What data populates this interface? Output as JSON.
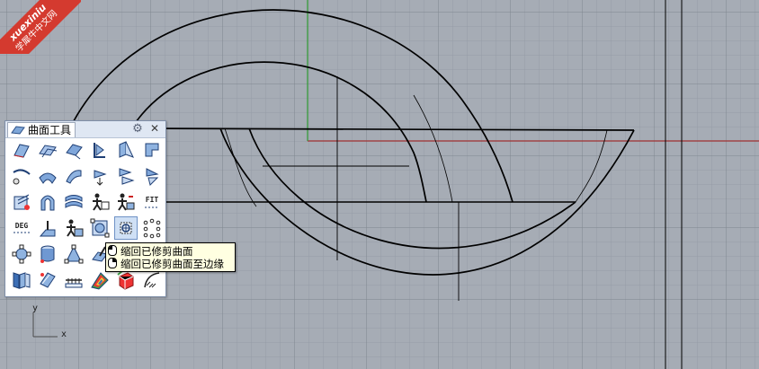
{
  "watermark": {
    "site": "xuexiniu",
    "name": "学犀牛中文网"
  },
  "toolbar": {
    "title": "曲面工具",
    "buttons": [
      {
        "icon": "blend-surface-icon"
      },
      {
        "icon": "offset-surface-icon"
      },
      {
        "icon": "extend-surface-icon"
      },
      {
        "icon": "fillet-surface-icon"
      },
      {
        "icon": "chamfer-surface-icon"
      },
      {
        "icon": "variable-fillet-icon"
      },
      {
        "icon": "connect-surface-icon"
      },
      {
        "icon": "blend-edge-icon"
      },
      {
        "icon": "match-surface-icon"
      },
      {
        "icon": "merge-surface-icon"
      },
      {
        "icon": "variable-chamfer-icon"
      },
      {
        "icon": "variable-blend-icon"
      },
      {
        "icon": "tween-surface-icon"
      },
      {
        "icon": "arch-surface-icon"
      },
      {
        "icon": "flow-surface-icon"
      },
      {
        "icon": "rebuild-surface-icon"
      },
      {
        "icon": "refit-surface-icon"
      },
      {
        "icon": "fit-surface-icon",
        "label": "FIT"
      },
      {
        "icon": "change-degree-icon",
        "label": "DEG"
      },
      {
        "icon": "adjust-seam-icon"
      },
      {
        "icon": "shrink-trimmed-icon"
      },
      {
        "icon": "untrim-icon"
      },
      {
        "icon": "shrink-to-edge-icon"
      },
      {
        "icon": "point-grid-icon"
      },
      {
        "icon": "make-periodic-icon"
      },
      {
        "icon": "cylinder-surface-icon"
      },
      {
        "icon": "symmetry-icon"
      },
      {
        "icon": "edit-control-icon"
      },
      {
        "icon": "",
        "label": ""
      },
      {
        "icon": "",
        "label": ""
      },
      {
        "icon": "unroll-surface-icon"
      },
      {
        "icon": "smash-surface-icon"
      },
      {
        "icon": "handle-surface-icon"
      },
      {
        "icon": "zebra-analysis-icon"
      },
      {
        "icon": "box-edit-icon"
      },
      {
        "icon": "surface-curvature-icon"
      }
    ]
  },
  "tooltip": {
    "line1": "缩回已修剪曲面",
    "line2": "缩回已修剪曲面至边缘"
  },
  "viewport": {
    "axis_x_label": "x",
    "axis_y_label": "y",
    "colors": {
      "background": "#a6acb5",
      "grid": "#8f969f",
      "grid_major": "#7d848d",
      "x_axis": "#a03030",
      "y_axis": "#2f9a32",
      "curve": "#000000"
    }
  }
}
